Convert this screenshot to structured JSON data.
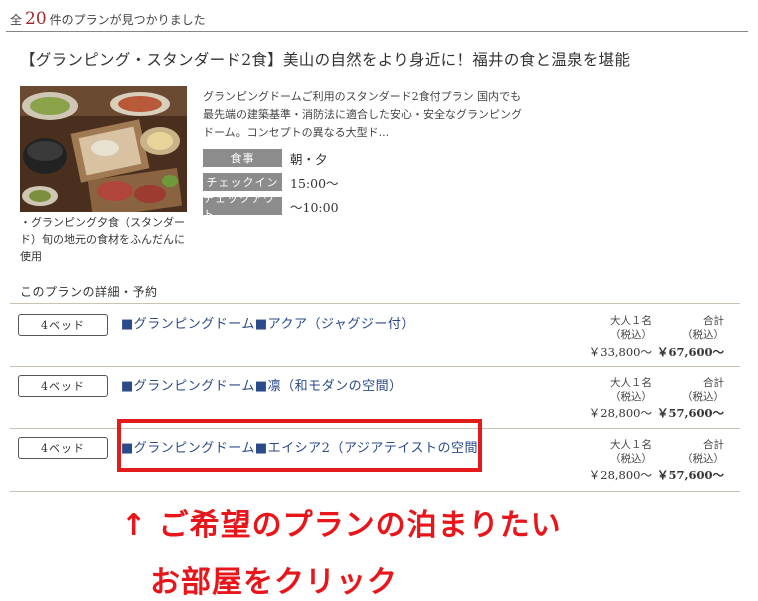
{
  "results": {
    "prefix": "全",
    "count": "20",
    "suffix": "件のプランが見つかりました"
  },
  "plan": {
    "title": "【グランピング・スタンダード2食】美山の自然をより身近に！福井の食と温泉を堪能",
    "caption": "・グランピング夕食（スタンダード）旬の地元の食材をふんだんに使用",
    "description": "グランピングドームご利用のスタンダード2食付プラン 国内でも最先端の建築基準・消防法に適合した安心・安全なグランピングドーム。コンセプトの異なる大型ド...",
    "info": [
      {
        "label": "食事",
        "value": "朝・夕"
      },
      {
        "label": "チェックイン",
        "value": "15:00〜"
      },
      {
        "label": "チェックアウト",
        "value": "〜10:00"
      }
    ]
  },
  "section_title": "このプランの詳細・予約",
  "rooms": [
    {
      "bed_label": "4ベッド",
      "name": "■グランピングドーム■アクア（ジャグジー付）",
      "per_label_1": "大人１名",
      "per_label_2": "（税込）",
      "per_price": "￥33,800〜",
      "total_label_1": "合計",
      "total_label_2": "（税込）",
      "total_price": "￥67,600〜"
    },
    {
      "bed_label": "4ベッド",
      "name": "■グランピングドーム■凛（和モダンの空間）",
      "per_label_1": "大人１名",
      "per_label_2": "（税込）",
      "per_price": "￥28,800〜",
      "total_label_1": "合計",
      "total_label_2": "（税込）",
      "total_price": "￥57,600〜"
    },
    {
      "bed_label": "4ベッド",
      "name": "■グランピングドーム■エイシア2（アジアテイストの空間）",
      "per_label_1": "大人１名",
      "per_label_2": "（税込）",
      "per_price": "￥28,800〜",
      "total_label_1": "合計",
      "total_label_2": "（税込）",
      "total_price": "￥57,600〜"
    }
  ],
  "annotation": {
    "line1": "↑ ご希望のプランの泊まりたい",
    "line2": "お部屋をクリック",
    "color": "#e8151b"
  },
  "colors": {
    "count_accent": "#a0282d",
    "link": "#2a4a8a",
    "info_label_bg": "#8c8c8c",
    "highlight": "#e41b1b"
  }
}
